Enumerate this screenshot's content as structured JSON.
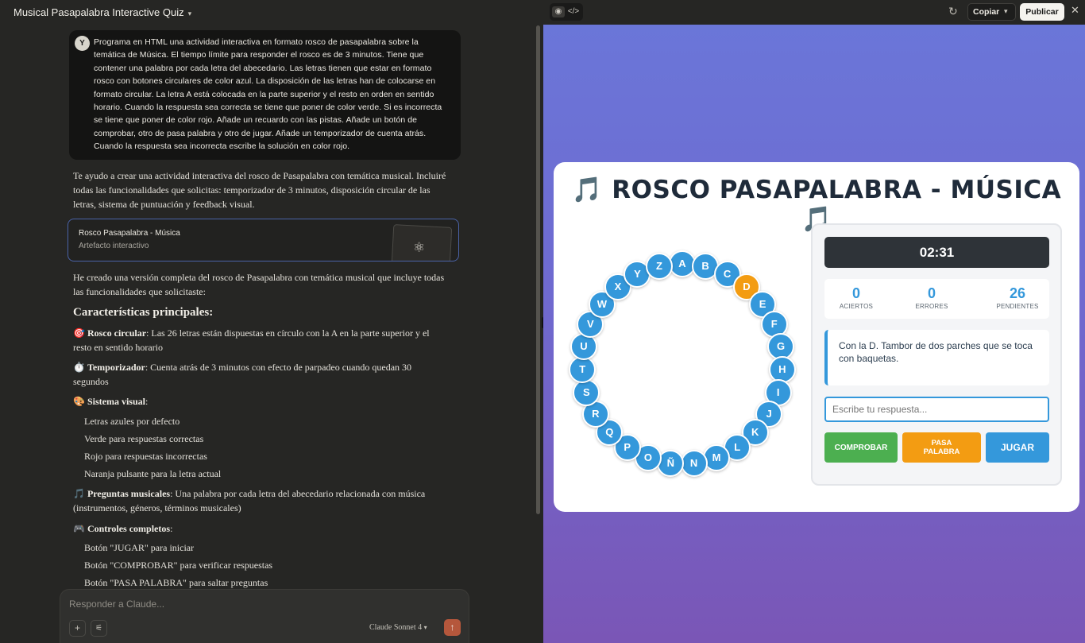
{
  "chat": {
    "title": "Musical Pasapalabra Interactive Quiz",
    "user_initial": "Y",
    "user_message": "Programa en HTML una actividad interactiva en formato rosco de pasapalabra sobre la temática de Música. El tiempo límite para responder el rosco es de 3 minutos. Tiene que contener una palabra por cada letra del abecedario. Las letras tienen que estar en formato rosco con botones circulares de color azul. La disposición de las letras han de colocarse en formato circular. La letra A está colocada en la parte superior y el resto en orden en sentido horario. Cuando la respuesta sea correcta se tiene que poner de color verde. Si es incorrecta se tiene que poner de color rojo. Añade un recuardo con las pistas. Añade un botón de comprobar, otro de pasa palabra y otro de jugar. Añade un temporizador de cuenta atrás. Cuando la respuesta sea incorrecta escribe la solución en color rojo.",
    "response_intro": "Te ayudo a crear una actividad interactiva del rosco de Pasapalabra con temática musical. Incluiré todas las funcionalidades que solicitas: temporizador de 3 minutos, disposición circular de las letras, sistema de puntuación y feedback visual.",
    "artifact": {
      "title": "Rosco Pasapalabra - Música",
      "subtitle": "Artefacto interactivo",
      "icon": "atom-icon"
    },
    "response_body": "He creado una versión completa del rosco de Pasapalabra con temática musical que incluye todas las funcionalidades que solicitaste:",
    "features_heading": "Características principales:",
    "features": {
      "rosco_icon": "🎯",
      "rosco_title": "Rosco circular",
      "rosco_text": ": Las 26 letras están dispuestas en círculo con la A en la parte superior y el resto en sentido horario",
      "timer_icon": "⏱️",
      "timer_title": "Temporizador",
      "timer_text": ": Cuenta atrás de 3 minutos con efecto de parpadeo cuando quedan 30 segundos",
      "visual_icon": "🎨",
      "visual_title": "Sistema visual",
      "visual_text": ":",
      "visual_items": [
        "Letras azules por defecto",
        "Verde para respuestas correctas",
        "Rojo para respuestas incorrectas",
        "Naranja pulsante para la letra actual"
      ],
      "questions_icon": "🎵",
      "questions_title": "Preguntas musicales",
      "questions_text": ": Una palabra por cada letra del abecedario relacionada con música (instrumentos, géneros, términos musicales)",
      "controls_icon": "🎮",
      "controls_title": "Controles completos",
      "controls_text": ":",
      "controls_items": [
        "Botón \"JUGAR\" para iniciar",
        "Botón \"COMPROBAR\" para verificar respuestas",
        "Botón \"PASA PALABRA\" para saltar preguntas"
      ]
    },
    "composer": {
      "placeholder": "Responder a Claude...",
      "add_icon": "plus-icon",
      "tools_icon": "sliders-icon",
      "model": "Claude Sonnet 4",
      "send_icon": "arrow-up-icon"
    }
  },
  "artifact_toolbar": {
    "preview_icon": "eye-icon",
    "code_icon": "code-icon",
    "refresh_icon": "refresh-icon",
    "copy_label": "Copiar",
    "publish_label": "Publicar",
    "close_icon": "close-icon"
  },
  "game": {
    "title": "🎵 ROSCO PASAPALABRA - MÚSICA 🎵",
    "letters": [
      "A",
      "B",
      "C",
      "D",
      "E",
      "F",
      "G",
      "H",
      "I",
      "J",
      "K",
      "L",
      "M",
      "N",
      "Ñ",
      "O",
      "P",
      "Q",
      "R",
      "S",
      "T",
      "U",
      "V",
      "W",
      "X",
      "Y",
      "Z"
    ],
    "active_letter": "D",
    "timer": "02:31",
    "stats": {
      "correct_value": "0",
      "correct_label": "ACIERTOS",
      "wrong_value": "0",
      "wrong_label": "ERRORES",
      "pending_value": "26",
      "pending_label": "PENDIENTES"
    },
    "question": "Con la D. Tambor de dos parches que se toca con baquetas.",
    "answer_placeholder": "Escribe tu respuesta...",
    "buttons": {
      "check": "COMPROBAR",
      "pass": "PASA PALABRA",
      "play": "JUGAR"
    },
    "colors": {
      "default": "#3498db",
      "active": "#f39c12",
      "correct": "#4caf50",
      "wrong": "#e74c3c"
    }
  }
}
